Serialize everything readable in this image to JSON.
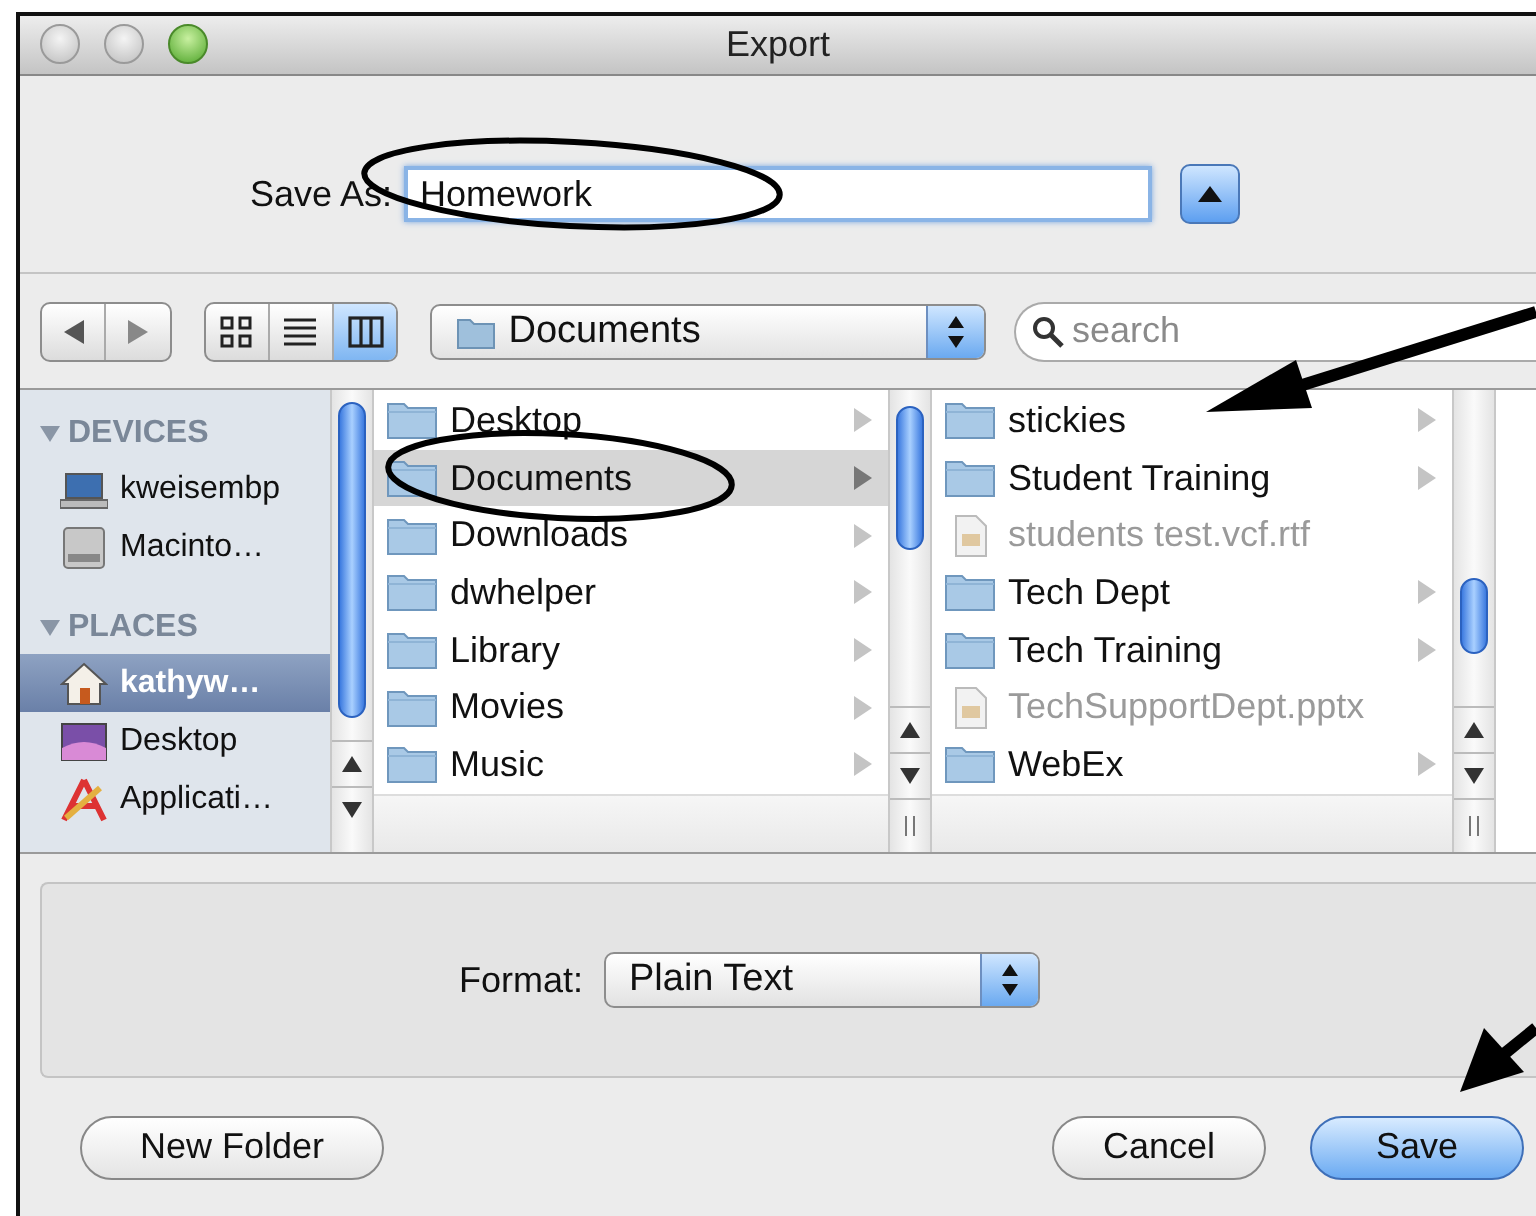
{
  "window": {
    "title": "Export"
  },
  "save_as": {
    "label": "Save As:",
    "value": "Homework"
  },
  "toolbar": {
    "view_modes": [
      {
        "selected": false
      },
      {
        "selected": false
      },
      {
        "selected": true
      }
    ],
    "location": "Documents",
    "search": {
      "placeholder": "search"
    }
  },
  "sidebar": [
    {
      "heading": "DEVICES",
      "expanded": true,
      "items": [
        {
          "label": "kweisembp",
          "kind": "laptop",
          "selected": false
        },
        {
          "label": "Macinto…",
          "kind": "disk",
          "selected": false
        }
      ]
    },
    {
      "heading": "PLACES",
      "expanded": true,
      "items": [
        {
          "label": "kathyw…",
          "kind": "home",
          "selected": true
        },
        {
          "label": "Desktop",
          "kind": "desktop",
          "selected": false
        },
        {
          "label": "Applicati…",
          "kind": "apps",
          "selected": false
        }
      ]
    }
  ],
  "columns": [
    {
      "items": [
        {
          "name": "Desktop",
          "kind": "folder",
          "selected": false,
          "disabled": false
        },
        {
          "name": "Documents",
          "kind": "folder",
          "selected": true,
          "disabled": false
        },
        {
          "name": "Downloads",
          "kind": "folder",
          "selected": false,
          "disabled": false
        },
        {
          "name": "dwhelper",
          "kind": "folder",
          "selected": false,
          "disabled": false
        },
        {
          "name": "Library",
          "kind": "folder",
          "selected": false,
          "disabled": false
        },
        {
          "name": "Movies",
          "kind": "folder",
          "selected": false,
          "disabled": false
        },
        {
          "name": "Music",
          "kind": "folder",
          "selected": false,
          "disabled": false
        }
      ]
    },
    {
      "items": [
        {
          "name": "stickies",
          "kind": "folder",
          "selected": false,
          "disabled": false
        },
        {
          "name": "Student Training",
          "kind": "folder",
          "selected": false,
          "disabled": false
        },
        {
          "name": "students test.vcf.rtf",
          "kind": "document",
          "selected": false,
          "disabled": true
        },
        {
          "name": "Tech Dept",
          "kind": "folder",
          "selected": false,
          "disabled": false
        },
        {
          "name": "Tech Training",
          "kind": "folder",
          "selected": false,
          "disabled": false
        },
        {
          "name": "TechSupportDept.pptx",
          "kind": "document",
          "selected": false,
          "disabled": true
        },
        {
          "name": "WebEx",
          "kind": "folder",
          "selected": false,
          "disabled": false
        }
      ]
    }
  ],
  "format": {
    "label": "Format:",
    "value": "Plain Text"
  },
  "buttons": [
    {
      "label": "New Folder",
      "default": false
    },
    {
      "label": "Cancel",
      "default": false
    },
    {
      "label": "Save",
      "default": true
    }
  ]
}
